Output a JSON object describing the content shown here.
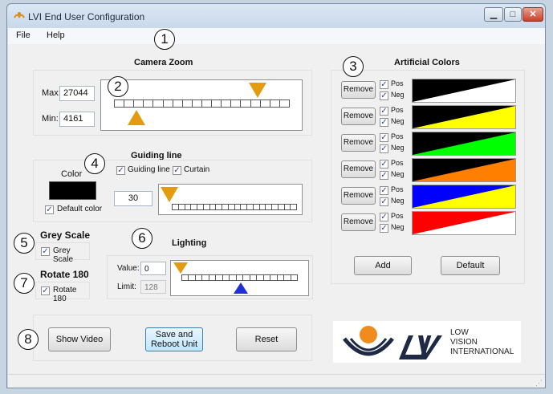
{
  "window": {
    "title": "LVI End User Configuration",
    "icon": "lvi-app-icon"
  },
  "menu": {
    "file": "File",
    "help": "Help"
  },
  "markers": [
    "1",
    "2",
    "3",
    "4",
    "5",
    "6",
    "7",
    "8"
  ],
  "camera_zoom": {
    "title": "Camera Zoom",
    "max_label": "Max:",
    "max_value": "27044",
    "min_label": "Min:",
    "min_value": "4161",
    "max_position": 0.85,
    "min_position": 0.12
  },
  "guiding_line": {
    "title": "Guiding line",
    "color_label": "Color",
    "color_value": "#000000",
    "default_color_label": "Default color",
    "default_color_checked": true,
    "guiding_line_label": "Guiding line",
    "guiding_line_checked": true,
    "curtain_label": "Curtain",
    "curtain_checked": true,
    "value": "30",
    "slider_position": 0.0
  },
  "grey_scale": {
    "title": "Grey Scale",
    "checkbox_label": "Grey Scale",
    "checked": true
  },
  "rotate": {
    "title": "Rotate 180",
    "checkbox_label": "Rotate 180",
    "checked": true
  },
  "lighting": {
    "title": "Lighting",
    "value_label": "Value:",
    "value": "0",
    "limit_label": "Limit:",
    "limit": "128",
    "value_position": 0.0,
    "limit_position": 0.5
  },
  "artificial_colors": {
    "title": "Artificial Colors",
    "remove_label": "Remove",
    "pos_label": "Pos",
    "neg_label": "Neg",
    "rows": [
      {
        "foreground": "#000000",
        "background": "#ffffff",
        "pos": true,
        "neg": true
      },
      {
        "foreground": "#000000",
        "background": "#ffff00",
        "pos": true,
        "neg": true
      },
      {
        "foreground": "#000000",
        "background": "#00ff00",
        "pos": true,
        "neg": true
      },
      {
        "foreground": "#000000",
        "background": "#ff8000",
        "pos": true,
        "neg": true
      },
      {
        "foreground": "#0000ff",
        "background": "#ffff00",
        "pos": true,
        "neg": true
      },
      {
        "foreground": "#ff0000",
        "background": "#ffffff",
        "pos": true,
        "neg": true
      }
    ],
    "add_label": "Add",
    "default_label": "Default"
  },
  "actions": {
    "show_video": "Show Video",
    "save_reboot_line1": "Save and",
    "save_reboot_line2": "Reboot Unit",
    "reset": "Reset"
  },
  "logo": {
    "brand": "LVI",
    "line1": "LOW",
    "line2": "VISION",
    "line3": "INTERNATIONAL"
  },
  "colors": {
    "slider_orange": "#e39b10",
    "slider_blue": "#1f2fd6"
  }
}
